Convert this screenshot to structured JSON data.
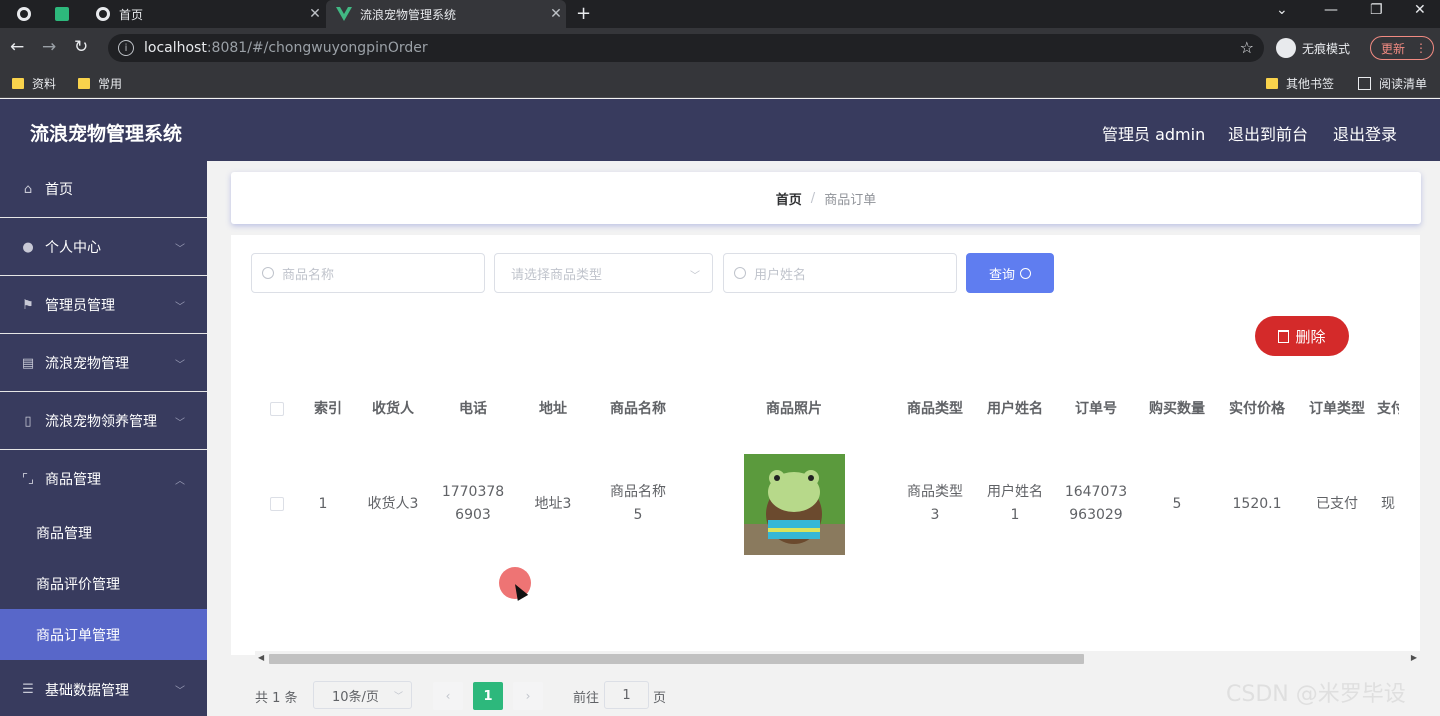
{
  "browser": {
    "tabs": [
      {
        "title": "首页",
        "active": false
      },
      {
        "title": "流浪宠物管理系统",
        "active": true
      }
    ],
    "url_host": "localhost",
    "url_path": ":8081/#/chongwuyongpinOrder",
    "incognito_label": "无痕模式",
    "update_label": "更新",
    "bookmarks": [
      "资料",
      "常用"
    ],
    "bookmarks_right": [
      "其他书签",
      "阅读清单"
    ]
  },
  "app": {
    "title": "流浪宠物管理系统",
    "header_links": [
      "管理员 admin",
      "退出到前台",
      "退出登录"
    ]
  },
  "sidebar": {
    "items": [
      {
        "label": "首页",
        "icon": "home-icon"
      },
      {
        "label": "个人中心",
        "icon": "user-icon"
      },
      {
        "label": "管理员管理",
        "icon": "flag-icon"
      },
      {
        "label": "流浪宠物管理",
        "icon": "document-icon"
      },
      {
        "label": "流浪宠物领养管理",
        "icon": "phone-icon"
      },
      {
        "label": "商品管理",
        "icon": "frame-icon"
      }
    ],
    "submenu": [
      "商品管理",
      "商品评价管理",
      "商品订单管理"
    ],
    "bottom_item": {
      "label": "基础数据管理",
      "icon": "list-icon"
    }
  },
  "breadcrumb": {
    "home": "首页",
    "separator": "/",
    "current": "商品订单"
  },
  "search": {
    "goods_name_placeholder": "商品名称",
    "goods_type_placeholder": "请选择商品类型",
    "user_name_placeholder": "用户姓名",
    "query_label": "查询",
    "delete_label": "删除"
  },
  "table": {
    "headers": [
      "索引",
      "收货人",
      "电话",
      "地址",
      "商品名称",
      "商品照片",
      "商品类型",
      "用户姓名",
      "订单号",
      "购买数量",
      "实付价格",
      "订单类型",
      "支付"
    ],
    "rows": [
      {
        "index": "1",
        "receiver": "收货人3",
        "phone_l1": "1770378",
        "phone_l2": "6903",
        "address": "地址3",
        "goods_name_l1": "商品名称",
        "goods_name_l2": "5",
        "goods_type_l1": "商品类型",
        "goods_type_l2": "3",
        "user_name_l1": "用户姓名",
        "user_name_l2": "1",
        "order_no_l1": "1647073",
        "order_no_l2": "963029",
        "quantity": "5",
        "price": "1520.1",
        "order_type": "已支付",
        "pay": "现"
      }
    ]
  },
  "pagination": {
    "total": "共 1 条",
    "page_size": "10条/页",
    "current_page": "1",
    "goto_label": "前往",
    "goto_value": "1",
    "page_unit": "页"
  },
  "watermark": "CSDN @米罗毕设",
  "colors": {
    "sidebar": "#383b5e",
    "active_menu": "#5867c9",
    "query": "#5f7df0",
    "delete": "#d42a2a",
    "page_active": "#2db87c"
  }
}
